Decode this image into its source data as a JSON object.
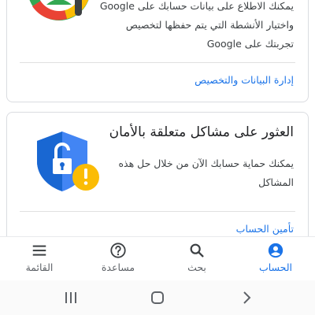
{
  "privacy_card": {
    "description": "يمكنك الاطلاع على بيانات حسابك على Google واختيار الأنشطة التي يتم حفظها لتخصيص تجربتك على Google",
    "link": "إدارة البيانات والتخصيص"
  },
  "security_card": {
    "title": "العثور على مشاكل متعلقة بالأمان",
    "description": "يمكنك حماية حسابك الآن من خلال حل هذه المشاكل",
    "link": "تأمين الحساب"
  },
  "bottom_nav": {
    "items": [
      {
        "label": "الحساب",
        "icon": "account-circle-icon",
        "active": true
      },
      {
        "label": "بحث",
        "icon": "search-icon",
        "active": false
      },
      {
        "label": "مساعدة",
        "icon": "help-icon",
        "active": false
      },
      {
        "label": "القائمة",
        "icon": "menu-icon",
        "active": false
      }
    ]
  },
  "system_nav": {
    "items": [
      {
        "icon": "recent-apps-icon"
      },
      {
        "icon": "home-icon"
      },
      {
        "icon": "back-icon"
      }
    ]
  },
  "colors": {
    "accent": "#1a73e8",
    "shield_blue": "#4285f4",
    "warning_yellow": "#fbbc04",
    "green": "#34a853",
    "red": "#ea4335"
  }
}
